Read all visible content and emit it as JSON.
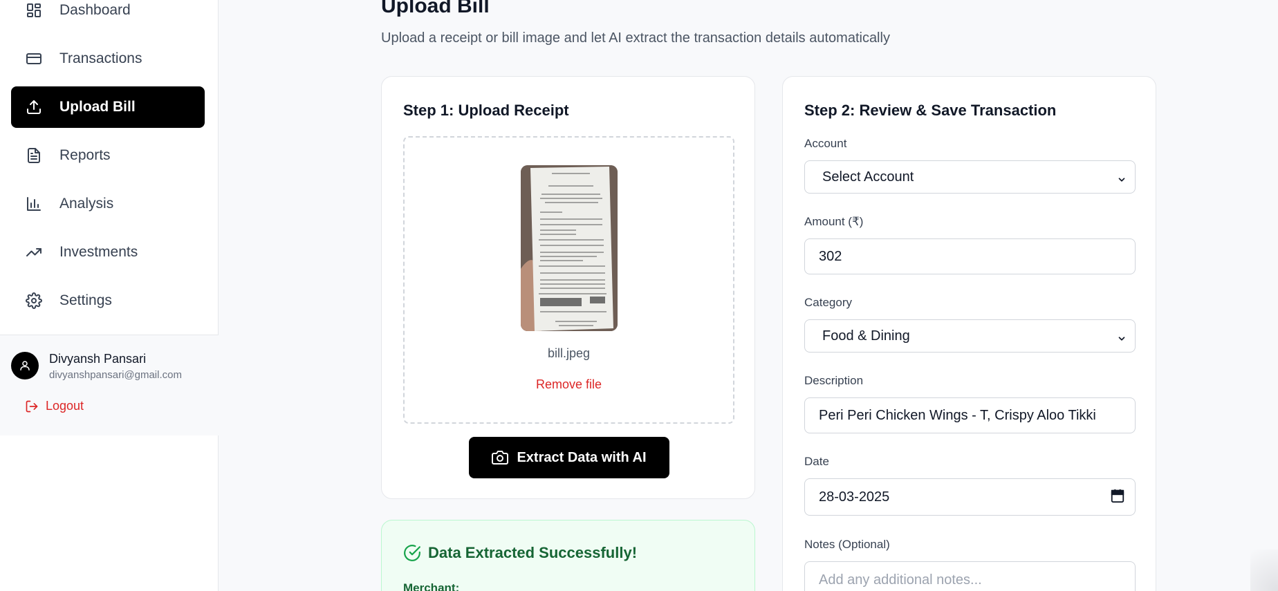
{
  "sidebar": {
    "items": [
      {
        "label": "Dashboard",
        "icon": "dashboard-icon"
      },
      {
        "label": "Transactions",
        "icon": "credit-card-icon"
      },
      {
        "label": "Upload Bill",
        "icon": "upload-icon",
        "active": true
      },
      {
        "label": "Reports",
        "icon": "file-text-icon"
      },
      {
        "label": "Analysis",
        "icon": "bar-chart-icon"
      },
      {
        "label": "Investments",
        "icon": "trending-up-icon"
      },
      {
        "label": "Settings",
        "icon": "gear-icon"
      }
    ],
    "user": {
      "name": "Divyansh Pansari",
      "email": "divyanshpansari@gmail.com"
    },
    "logout_label": "Logout"
  },
  "main": {
    "title": "Upload Bill",
    "subtitle": "Upload a receipt or bill image and let AI extract the transaction details automatically",
    "step1": {
      "title": "Step 1: Upload Receipt",
      "file_name": "bill.jpeg",
      "remove_label": "Remove file",
      "extract_label": "Extract Data with AI"
    },
    "success": {
      "title": "Data Extracted Successfully!",
      "merchant_label": "Merchant:"
    },
    "step2": {
      "title": "Step 2: Review & Save Transaction",
      "account_label": "Account",
      "account_value": "Select Account",
      "amount_label": "Amount (₹)",
      "amount_value": "302",
      "category_label": "Category",
      "category_value": "Food & Dining",
      "description_label": "Description",
      "description_value": "Peri Peri Chicken Wings - T, Crispy Aloo Tikki",
      "date_label": "Date",
      "date_value": "28-03-2025",
      "notes_label": "Notes (Optional)",
      "notes_placeholder": "Add any additional notes..."
    }
  },
  "colors": {
    "active_nav_bg": "#000000",
    "danger": "#dc2626",
    "success_bg": "#f0fdf4",
    "success_text": "#166534"
  }
}
